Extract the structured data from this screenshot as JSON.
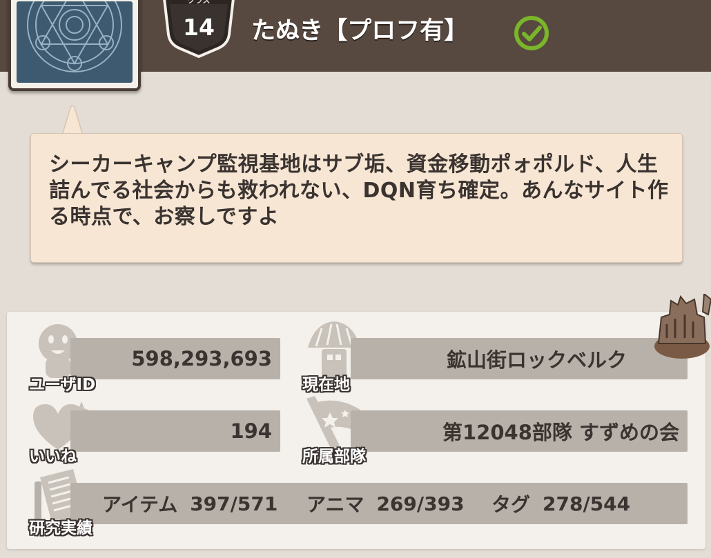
{
  "header": {
    "class_label": "クラス",
    "class_level": "14",
    "player_name": "たぬき【プロフ有】"
  },
  "comment": {
    "text": "シーカーキャンプ監視基地はサブ垢、資金移動ポォポルド、人生詰んでる社会からも救われない、DQN育ち確定。あんなサイト作る時点で、お察しですよ"
  },
  "profile": {
    "user_id": {
      "label": "ユーザID",
      "value": "598,293,693"
    },
    "location": {
      "label": "現在地",
      "value": "鉱山街ロックベルク"
    },
    "likes": {
      "label": "いいね",
      "value": "194"
    },
    "squad": {
      "label": "所属部隊",
      "value": "第12048部隊 すずめの会"
    },
    "research": {
      "label": "研究実績",
      "items": [
        {
          "name": "アイテム",
          "value": "397/571"
        },
        {
          "name": "アニマ",
          "value": "269/393"
        },
        {
          "name": "タグ",
          "value": "278/544"
        }
      ]
    }
  },
  "colors": {
    "header": "#574840",
    "background": "#e3ddd6",
    "bubble": "#f7e6d4",
    "value_bar": "#b8b1aa",
    "verified_green": "#7ab52a"
  }
}
